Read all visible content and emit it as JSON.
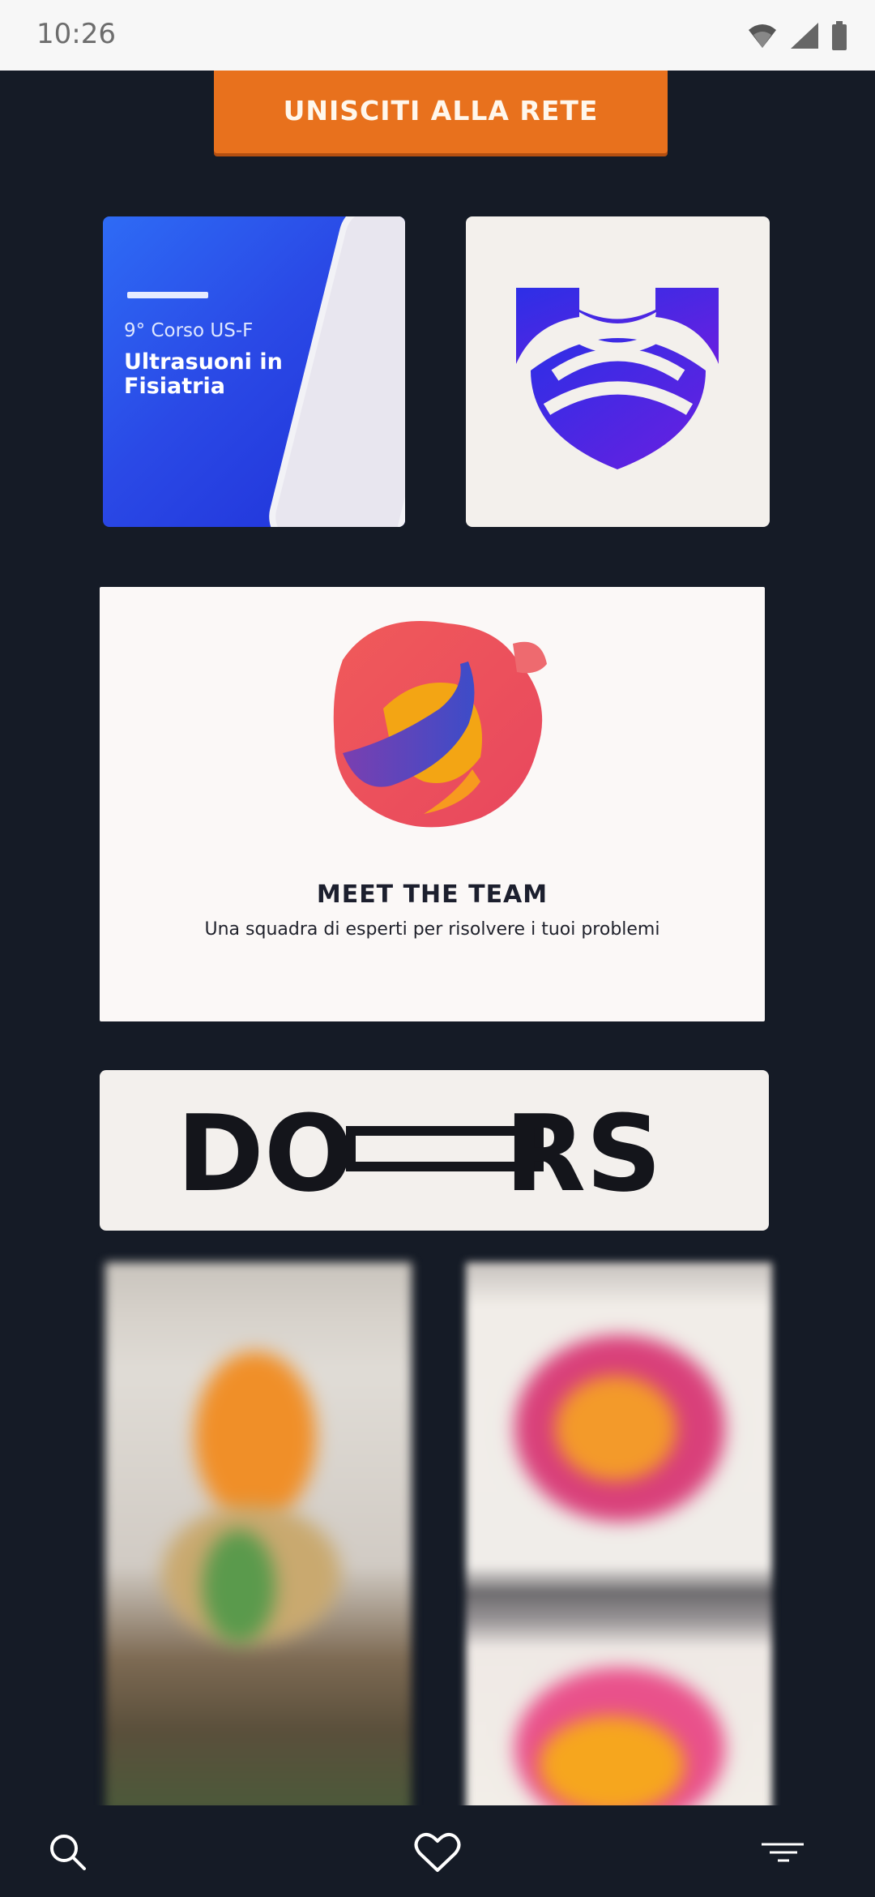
{
  "status_bar": {
    "time": "10:26",
    "icons": [
      "wifi-icon",
      "signal-icon",
      "battery-icon"
    ]
  },
  "cta": {
    "label": "UNISCITI ALLA RETE"
  },
  "tiles": {
    "course": {
      "subtitle": "9° Corso US-F",
      "title": "Ultrasuoni in Fisiatria"
    },
    "team": {
      "heading": "MEET THE TEAM",
      "tagline": "Una squadra di esperti per risolvere i tuoi problemi"
    },
    "doors": {
      "wordmark_left": "DO",
      "wordmark_right": "RS"
    }
  },
  "bottom_nav": {
    "items": [
      "search-icon",
      "heart-icon",
      "menu-icon"
    ]
  },
  "colors": {
    "background": "#151b26",
    "accent_orange": "#e8711d",
    "course_blue": "#2a49e6",
    "logo_purple": "#4b1fe0"
  }
}
